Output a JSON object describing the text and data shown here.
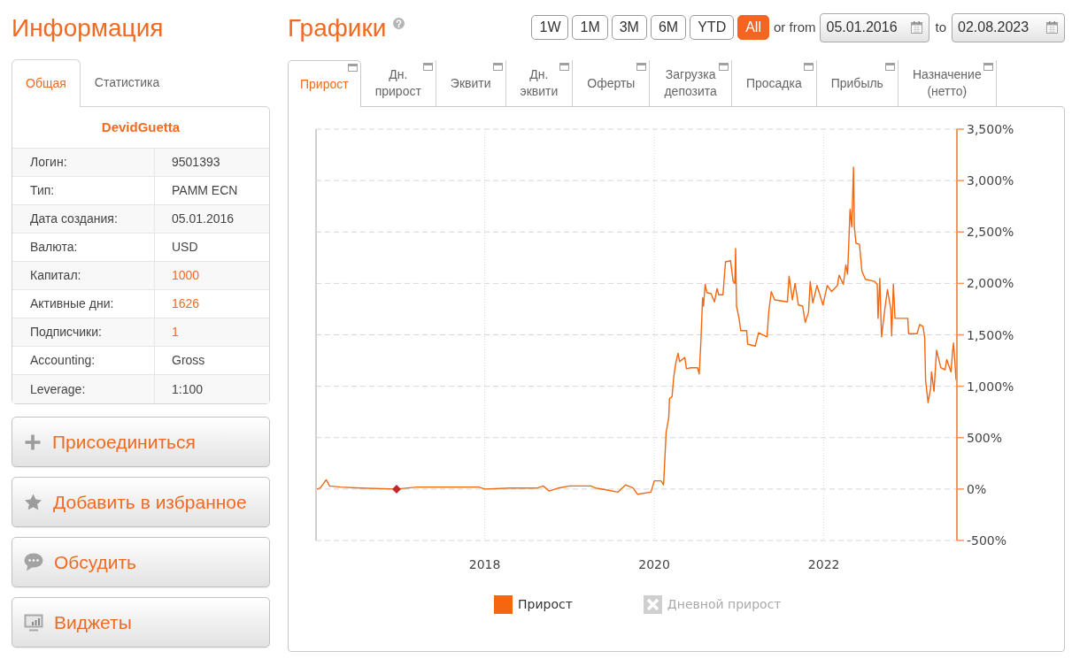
{
  "info": {
    "title": "Информация",
    "tabs": [
      {
        "label": "Общая",
        "selected": true
      },
      {
        "label": "Статистика",
        "selected": false
      }
    ],
    "name": "DevidGuetta",
    "rows": [
      {
        "label": "Логин:",
        "value": "9501393",
        "link": false
      },
      {
        "label": "Тип:",
        "value": "PAMM ECN",
        "link": false
      },
      {
        "label": "Дата создания:",
        "value": "05.01.2016",
        "link": false
      },
      {
        "label": "Валюта:",
        "value": "USD",
        "link": false
      },
      {
        "label": "Капитал:",
        "value": "1000",
        "link": true
      },
      {
        "label": "Активные дни:",
        "value": "1626",
        "link": true
      },
      {
        "label": "Подписчики:",
        "value": "1",
        "link": true
      },
      {
        "label": "Accounting:",
        "value": "Gross",
        "link": false
      },
      {
        "label": "Leverage:",
        "value": "1:100",
        "link": false
      }
    ]
  },
  "actions": [
    "Присоединиться",
    "Добавить в избранное",
    "Обсудить",
    "Виджеты"
  ],
  "charts": {
    "title": "Графики",
    "ranges": [
      {
        "label": "1W",
        "selected": false
      },
      {
        "label": "1M",
        "selected": false
      },
      {
        "label": "3M",
        "selected": false
      },
      {
        "label": "6M",
        "selected": false
      },
      {
        "label": "YTD",
        "selected": false
      },
      {
        "label": "All",
        "selected": true
      }
    ],
    "from_label": "or from",
    "from_date": "05.01.2016",
    "to_label": "to",
    "to_date": "02.08.2023",
    "tabs": [
      {
        "label": "Прирост",
        "selected": true
      },
      {
        "label": "Дн. прирост",
        "selected": false
      },
      {
        "label": "Эквити",
        "selected": false
      },
      {
        "label": "Дн. эквити",
        "selected": false
      },
      {
        "label": "Оферты",
        "selected": false
      },
      {
        "label": "Загрузка депозита",
        "selected": false
      },
      {
        "label": "Просадка",
        "selected": false
      },
      {
        "label": "Прибыль",
        "selected": false
      },
      {
        "label": "Назначение (нетто)",
        "selected": false
      }
    ],
    "chart_data": {
      "type": "line",
      "x": [
        2016.02,
        2016.06,
        2016.13,
        2016.17,
        2016.3,
        2016.54,
        2016.96,
        2017.2,
        2017.93,
        2018.0,
        2018.3,
        2018.62,
        2018.69,
        2018.76,
        2018.87,
        2019.0,
        2019.25,
        2019.31,
        2019.45,
        2019.57,
        2019.66,
        2019.75,
        2019.8,
        2019.96,
        2020.0,
        2020.08,
        2020.11,
        2020.14,
        2020.17,
        2020.18,
        2020.21,
        2020.23,
        2020.25,
        2020.28,
        2020.3,
        2020.36,
        2020.38,
        2020.43,
        2020.51,
        2020.53,
        2020.55,
        2020.57,
        2020.58,
        2020.6,
        2020.62,
        2020.67,
        2020.71,
        2020.74,
        2020.76,
        2020.81,
        2020.84,
        2020.9,
        2020.93,
        2020.95,
        2020.96,
        2020.97,
        2021.0,
        2021.02,
        2021.09,
        2021.1,
        2021.19,
        2021.23,
        2021.33,
        2021.35,
        2021.38,
        2021.42,
        2021.57,
        2021.59,
        2021.63,
        2021.66,
        2021.7,
        2021.75,
        2021.78,
        2021.82,
        2021.84,
        2021.87,
        2021.92,
        2021.99,
        2022.04,
        2022.09,
        2022.16,
        2022.18,
        2022.23,
        2022.26,
        2022.28,
        2022.31,
        2022.33,
        2022.35,
        2022.36,
        2022.38,
        2022.42,
        2022.45,
        2022.49,
        2022.6,
        2022.63,
        2022.64,
        2022.66,
        2022.68,
        2022.72,
        2022.75,
        2022.79,
        2022.8,
        2022.82,
        2022.84,
        2022.99,
        2023.0,
        2023.1,
        2023.13,
        2023.17,
        2023.19,
        2023.2,
        2023.23,
        2023.26,
        2023.27,
        2023.3,
        2023.33,
        2023.38,
        2023.43,
        2023.45,
        2023.5,
        2023.52,
        2023.53,
        2023.55,
        2023.56
      ],
      "series": [
        {
          "color": "#f4660f",
          "values": [
            0,
            10,
            90,
            30,
            20,
            10,
            0,
            20,
            20,
            0,
            10,
            10,
            30,
            -20,
            10,
            30,
            30,
            10,
            -10,
            -30,
            40,
            10,
            -50,
            -30,
            80,
            80,
            40,
            550,
            690,
            880,
            900,
            1090,
            1210,
            1320,
            1240,
            1280,
            1170,
            1180,
            1180,
            1120,
            1440,
            1860,
            1780,
            1990,
            1910,
            1900,
            1820,
            1950,
            1890,
            1890,
            2210,
            2220,
            2020,
            2000,
            2340,
            1780,
            1660,
            1540,
            1540,
            1410,
            1390,
            1520,
            1480,
            1720,
            1920,
            1840,
            1820,
            2070,
            1840,
            2000,
            1790,
            1780,
            1620,
            1720,
            2020,
            1810,
            1980,
            1790,
            1980,
            1920,
            1980,
            2080,
            1990,
            2180,
            2090,
            2720,
            2550,
            3130,
            2550,
            2390,
            2380,
            2120,
            2040,
            2020,
            1990,
            1660,
            2050,
            1480,
            1750,
            1940,
            1750,
            1490,
            1990,
            1660,
            1660,
            1510,
            1510,
            1600,
            1580,
            1470,
            1060,
            840,
            980,
            1140,
            950,
            1350,
            1180,
            1160,
            1260,
            1140,
            1350,
            1420,
            1180,
            1060
          ]
        }
      ],
      "xlim": [
        2016.01,
        2023.57
      ],
      "ylim": [
        -500,
        3500
      ],
      "xticks": [
        2018,
        2020,
        2022
      ],
      "yticks": [
        {
          "value": -500,
          "label": "-500%"
        },
        {
          "value": 0,
          "label": "0%"
        },
        {
          "value": 500,
          "label": "500%"
        },
        {
          "value": 1000,
          "label": "1,000%"
        },
        {
          "value": 1500,
          "label": "1,500%"
        },
        {
          "value": 2000,
          "label": "2,000%"
        },
        {
          "value": 2500,
          "label": "2,500%"
        },
        {
          "value": 3000,
          "label": "3,000%"
        },
        {
          "value": 3500,
          "label": "3,500%"
        }
      ],
      "grid": true
    },
    "legend": [
      {
        "label": "Прирост",
        "visible": true
      },
      {
        "label": "Дневной прирост",
        "visible": false
      }
    ]
  }
}
